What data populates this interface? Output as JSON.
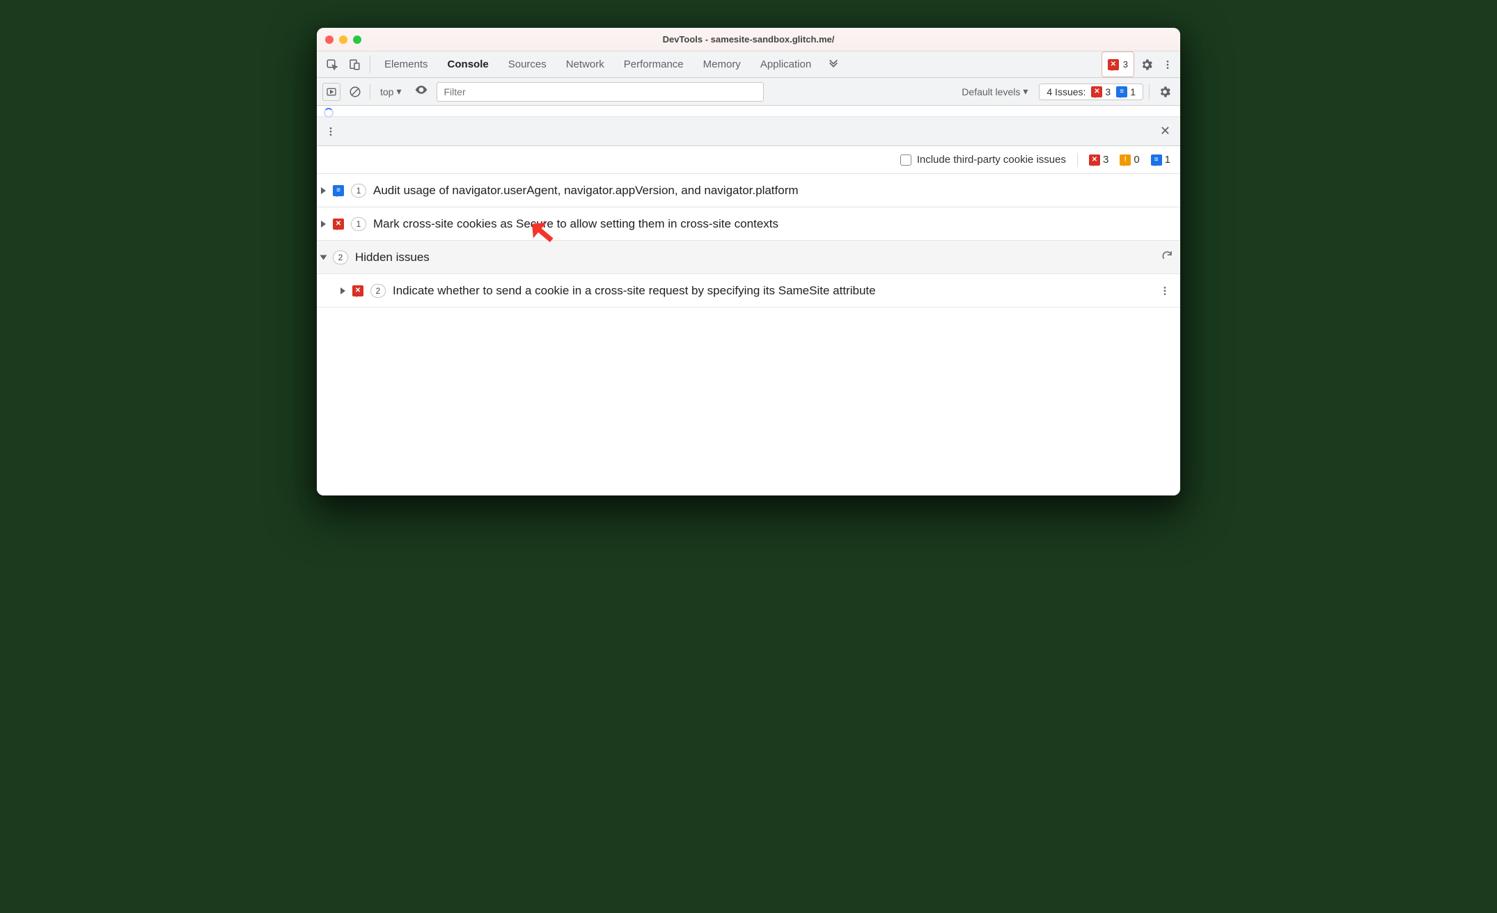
{
  "window": {
    "title": "DevTools - samesite-sandbox.glitch.me/"
  },
  "tabs": {
    "items": [
      "Elements",
      "Console",
      "Sources",
      "Network",
      "Performance",
      "Memory",
      "Application"
    ],
    "active": "Console",
    "errors_count": "3"
  },
  "console_toolbar": {
    "context": "top",
    "filter_placeholder": "Filter",
    "levels_label": "Default levels",
    "issues_label": "4 Issues:",
    "issues_red": "3",
    "issues_blue": "1"
  },
  "filterbar": {
    "checkbox_label": "Include third-party cookie issues",
    "badge_red": "3",
    "badge_orange": "0",
    "badge_blue": "1"
  },
  "issues": {
    "row0": {
      "count": "1",
      "text": "Audit usage of navigator.userAgent, navigator.appVersion, and navigator.platform"
    },
    "row1": {
      "count": "1",
      "text": "Mark cross-site cookies as Secure to allow setting them in cross-site contexts"
    },
    "hidden": {
      "count": "2",
      "label": "Hidden issues"
    },
    "row2": {
      "count": "2",
      "text": "Indicate whether to send a cookie in a cross-site request by specifying its SameSite attribute"
    }
  }
}
